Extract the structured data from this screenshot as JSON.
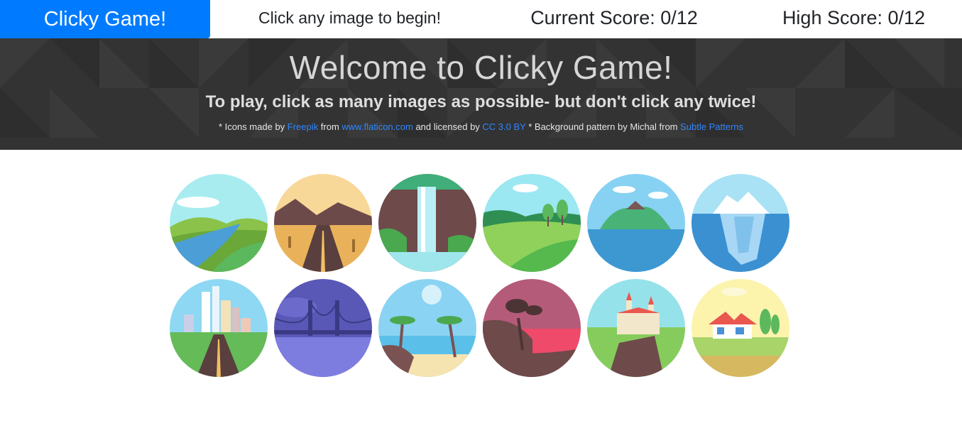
{
  "navbar": {
    "brand": "Clicky Game!",
    "message": "Click any image to begin!",
    "current_score": "Current Score: 0/12",
    "high_score": "High Score: 0/12",
    "brand_color": "#007bff"
  },
  "hero": {
    "title": "Welcome to Clicky Game!",
    "subtitle": "To play, click as many images as possible- but don't click any twice!",
    "credits": {
      "prefix": "* Icons made by",
      "link_freepik": "Freepik",
      "from": "from",
      "link_flaticon": "www.flaticon.com",
      "licensed": "and licensed by",
      "link_license": "CC 3.0 BY",
      "background_note": "* Background pattern by Michal from",
      "link_subtle": "Subtle Patterns"
    },
    "background_color": "#333333"
  },
  "images": [
    {
      "name": "river-valley",
      "icon": "landscape-river-icon"
    },
    {
      "name": "desert-road",
      "icon": "landscape-desert-icon"
    },
    {
      "name": "waterfall",
      "icon": "landscape-waterfall-icon"
    },
    {
      "name": "green-hills",
      "icon": "landscape-hills-icon"
    },
    {
      "name": "island",
      "icon": "landscape-island-icon"
    },
    {
      "name": "iceberg",
      "icon": "landscape-iceberg-icon"
    },
    {
      "name": "city-road",
      "icon": "landscape-city-icon"
    },
    {
      "name": "bridge-night",
      "icon": "landscape-bridge-icon"
    },
    {
      "name": "palm-beach",
      "icon": "landscape-beach-icon"
    },
    {
      "name": "sunset-tree",
      "icon": "landscape-sunset-icon"
    },
    {
      "name": "castle-cliff",
      "icon": "landscape-castle-icon"
    },
    {
      "name": "country-house",
      "icon": "landscape-house-icon"
    }
  ]
}
